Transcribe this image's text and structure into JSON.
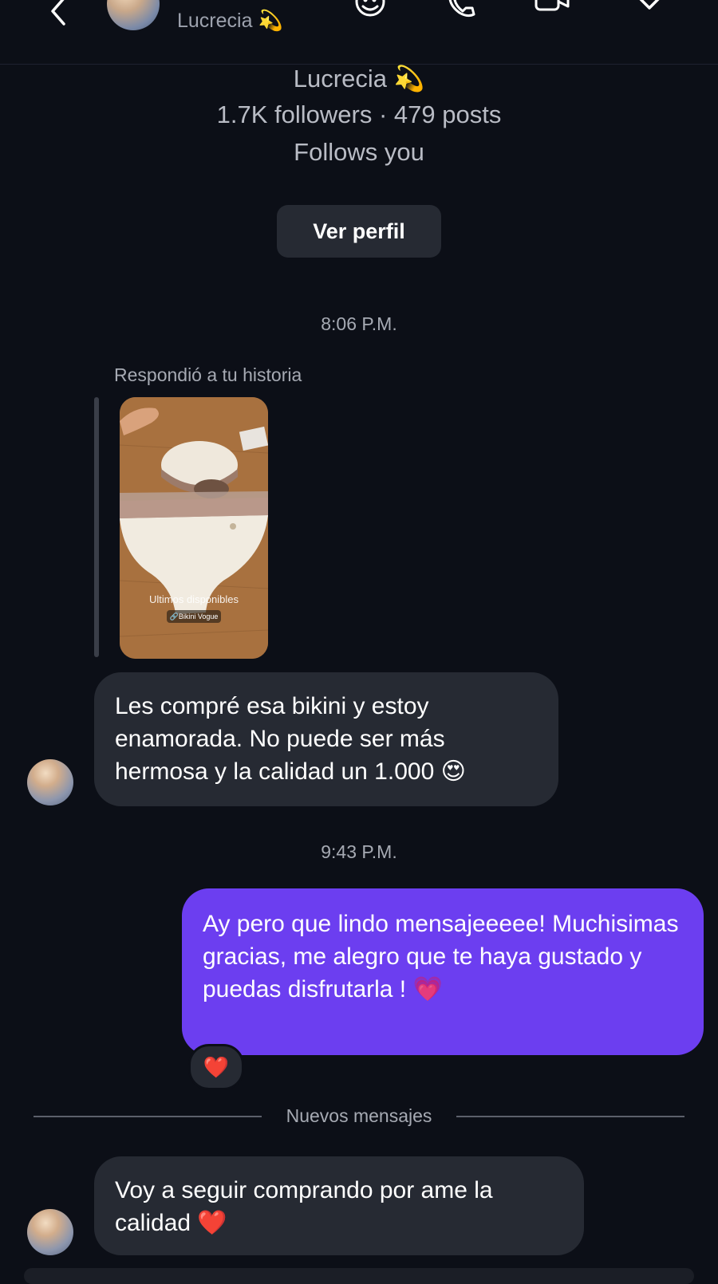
{
  "header": {
    "contact_name": "Lucrecia 💫"
  },
  "profile": {
    "name": "Lucrecia 💫",
    "stats": "1.7K followers · 479 posts",
    "follows_you": "Follows you",
    "view_profile_label": "Ver perfil"
  },
  "messages": {
    "time1": "8:06 P.M.",
    "reply_label": "Respondió a tu historia",
    "story_caption": "Ultimos disponibles",
    "story_tag": "Bikini Vogue",
    "msg1": "Les compré esa bikini y estoy enamorada. No puede ser más hermosa y la  calidad un 1.000 😍",
    "time2": "9:43 P.M.",
    "msg2": "Ay pero que lindo mensajeeeee! Muchisimas gracias, me alegro que te haya gustado y puedas disfrutarla ! 💗",
    "reaction": "❤️",
    "new_messages_label": "Nuevos mensajes",
    "msg3": "Voy a seguir comprando por ame la calidad ❤️"
  },
  "colors": {
    "background": "#0c0f17",
    "incoming_bubble": "#262a33",
    "outgoing_bubble": "#6c3ef0"
  }
}
